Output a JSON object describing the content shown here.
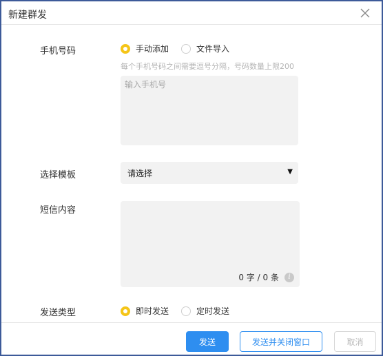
{
  "dialog": {
    "title": "新建群发"
  },
  "phone": {
    "label": "手机号码",
    "options": [
      {
        "label": "手动添加",
        "checked": true
      },
      {
        "label": "文件导入",
        "checked": false
      }
    ],
    "hint": "每个手机号码之间需要逗号分隔，号码数量上限200",
    "placeholder": "输入手机号",
    "value": ""
  },
  "template": {
    "label": "选择模板",
    "selected": "请选择",
    "arrow": "▼"
  },
  "content": {
    "label": "短信内容",
    "value": "",
    "counter": "0 字 / 0 条",
    "info_icon": "i"
  },
  "send_type": {
    "label": "发送类型",
    "options": [
      {
        "label": "即时发送",
        "checked": true
      },
      {
        "label": "定时发送",
        "checked": false
      }
    ]
  },
  "footer": {
    "send_label": "发送",
    "send_close_label": "发送并关闭窗口",
    "cancel_label": "取消"
  },
  "colors": {
    "accent": "#2e8ef0",
    "radio_checked": "#f5c518",
    "frame": "#3d5a99"
  }
}
